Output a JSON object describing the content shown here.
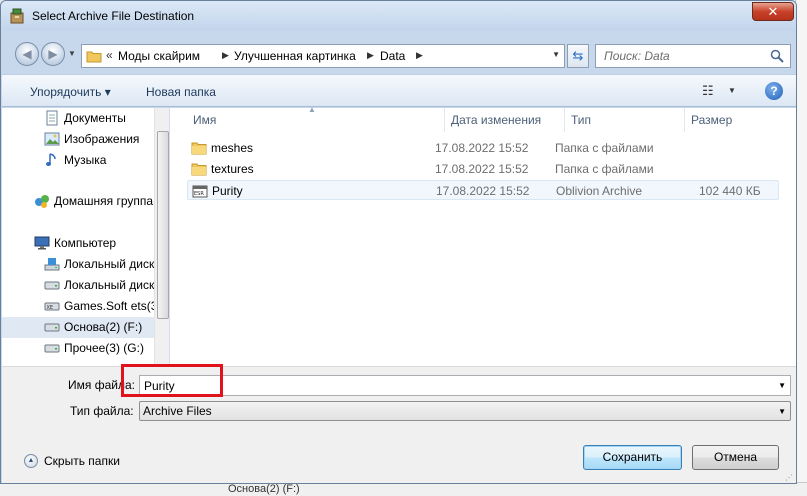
{
  "window": {
    "title": "Select Archive File Destination"
  },
  "address": {
    "breadcrumbs": [
      "Моды скайрим",
      "Улучшенная картинка",
      "Data"
    ],
    "search_placeholder": "Поиск: Data"
  },
  "toolbar": {
    "organize_label": "Упорядочить ▾",
    "new_folder_label": "Новая папка",
    "help_label": "?"
  },
  "navpane": {
    "items": [
      {
        "label": "Документы",
        "icon": "documents-icon"
      },
      {
        "label": "Изображения",
        "icon": "pictures-icon"
      },
      {
        "label": "Музыка",
        "icon": "music-icon"
      },
      {
        "label": "Домашняя группа",
        "icon": "homegroup-icon"
      },
      {
        "label": "Компьютер",
        "icon": "computer-icon"
      },
      {
        "label": "Локальный диск",
        "icon": "system-drive-icon"
      },
      {
        "label": "Локальный диск",
        "icon": "drive-icon"
      },
      {
        "label": "Games.Soft ets(3:",
        "icon": "drive-icon"
      },
      {
        "label": "Основа(2) (F:)",
        "icon": "drive-icon"
      },
      {
        "label": "Прочее(3) (G:)",
        "icon": "drive-icon"
      }
    ]
  },
  "filelist": {
    "columns": [
      "Имя",
      "Дата изменения",
      "Тип",
      "Размер"
    ],
    "rows": [
      {
        "name": "meshes",
        "date": "17.08.2022 15:52",
        "type": "Папка с файлами",
        "size": "",
        "icon": "folder-icon"
      },
      {
        "name": "textures",
        "date": "17.08.2022 15:52",
        "type": "Папка с файлами",
        "size": "",
        "icon": "folder-icon"
      },
      {
        "name": "Purity",
        "date": "17.08.2022 15:52",
        "type": "Oblivion Archive",
        "size": "102 440 КБ",
        "icon": "bsa-file-icon"
      }
    ]
  },
  "form": {
    "filename_label": "Имя файла:",
    "filename_value": "Purity",
    "filetype_label": "Тип файла:",
    "filetype_value": "Archive Files",
    "hide_folders_label": "Скрыть папки",
    "save_label": "Сохранить",
    "cancel_label": "Отмена"
  },
  "background": {
    "bottom_text": "Основа(2) (F:)"
  },
  "colors": {
    "highlight": "#e0131c",
    "title_bar": "#c2d5ec",
    "close_button": "#c7422a"
  }
}
